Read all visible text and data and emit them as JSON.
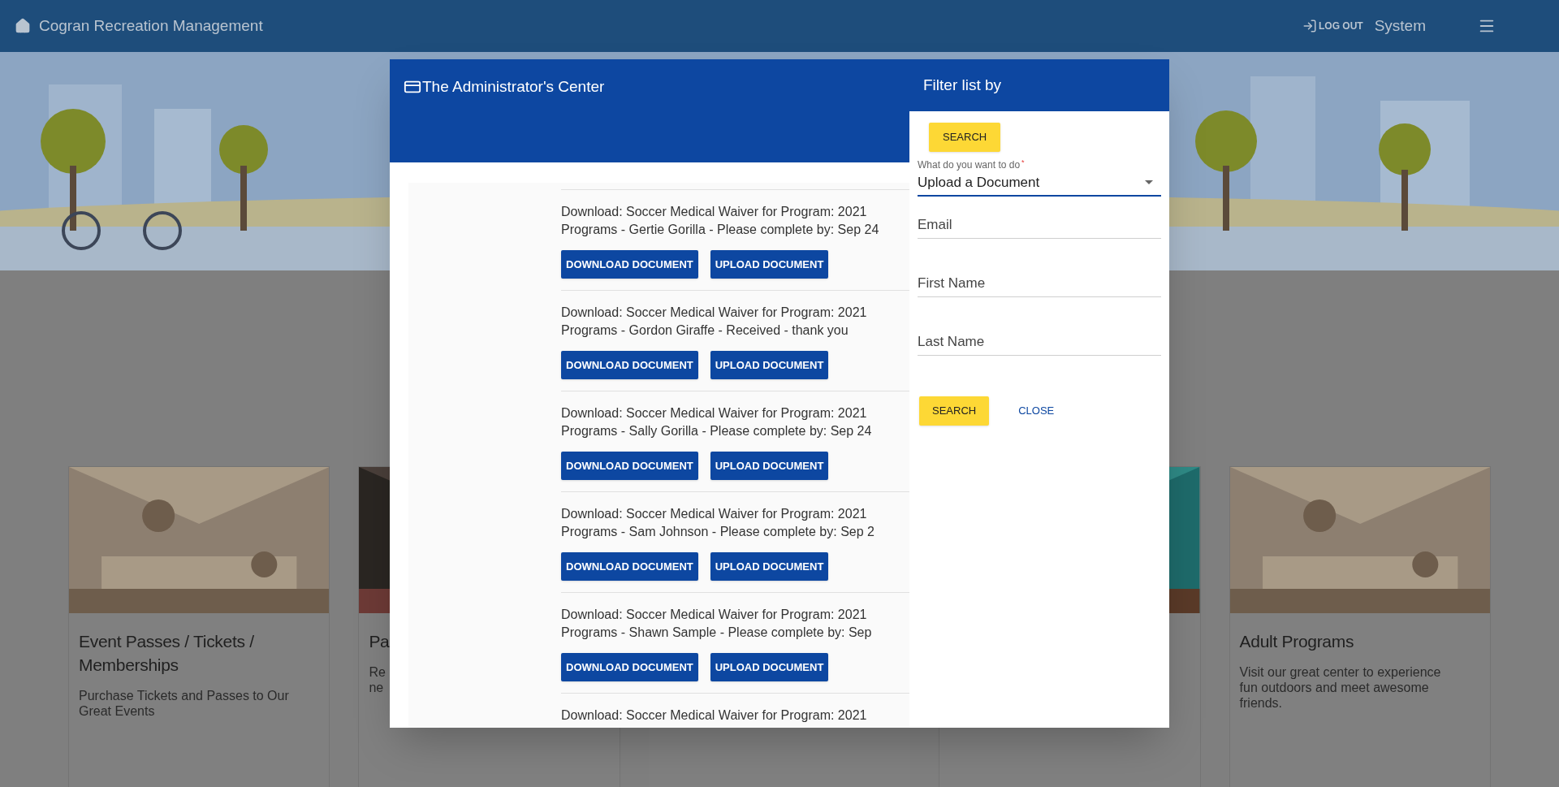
{
  "header": {
    "title": "Cogran Recreation Management",
    "logout": "LOG OUT",
    "user": "System"
  },
  "hero": {
    "kind": "picture"
  },
  "cards": [
    {
      "image": {
        "kind": "picture"
      },
      "title": "Event Passes / Tickets / Memberships",
      "description": [
        "Purchase Tickets and Passes to Our",
        "Great Events"
      ]
    },
    {
      "image": {
        "kind": "picture"
      },
      "title": "Pa",
      "description": [
        "Re",
        "ne"
      ]
    },
    {
      "image": {
        "kind": "picture"
      }
    },
    {
      "image": {
        "kind": "picture"
      },
      "title": "Adult Programs",
      "description": [
        "Visit our great center to experience",
        "fun outdoors and meet awesome",
        "friends."
      ]
    }
  ],
  "dialog": {
    "title": "The Administrator's Center",
    "documents": [
      {
        "lines": [
          "Download: Soccer Medical Waiver for Program: 2021",
          "Programs - Gertie Gorilla - Please complete by: Sep 24"
        ],
        "buttons": [
          "DOWNLOAD DOCUMENT",
          "UPLOAD DOCUMENT"
        ]
      },
      {
        "lines": [
          "Download: Soccer Medical Waiver for Program: 2021",
          "Programs - Gordon Giraffe - Received - thank you"
        ],
        "buttons": [
          "DOWNLOAD DOCUMENT",
          "UPLOAD DOCUMENT"
        ]
      },
      {
        "lines": [
          "Download: Soccer Medical Waiver for Program: 2021",
          "Programs - Sally Gorilla - Please complete by: Sep 24"
        ],
        "buttons": [
          "DOWNLOAD DOCUMENT",
          "UPLOAD DOCUMENT"
        ]
      },
      {
        "lines": [
          "Download: Soccer Medical Waiver for Program: 2021",
          "Programs - Sam Johnson - Please complete by: Sep 2"
        ],
        "buttons": [
          "DOWNLOAD DOCUMENT",
          "UPLOAD DOCUMENT"
        ]
      },
      {
        "lines": [
          "Download: Soccer Medical Waiver for Program: 2021",
          "Programs - Shawn Sample - Please complete by: Sep"
        ],
        "buttons": [
          "DOWNLOAD DOCUMENT",
          "UPLOAD DOCUMENT"
        ]
      },
      {
        "lines": [
          "Download: Soccer Medical Waiver for Program: 2021"
        ]
      }
    ]
  },
  "filter": {
    "title": "Filter list by",
    "top_button": "SEARCH",
    "select": {
      "label": "What do you want to do",
      "required_mark": "*",
      "value": "Upload a Document"
    },
    "fields": [
      {
        "placeholder": "Email"
      },
      {
        "placeholder": "First Name"
      },
      {
        "placeholder": "Last Name"
      }
    ],
    "search_button": "SEARCH",
    "close_button": "CLOSE"
  }
}
